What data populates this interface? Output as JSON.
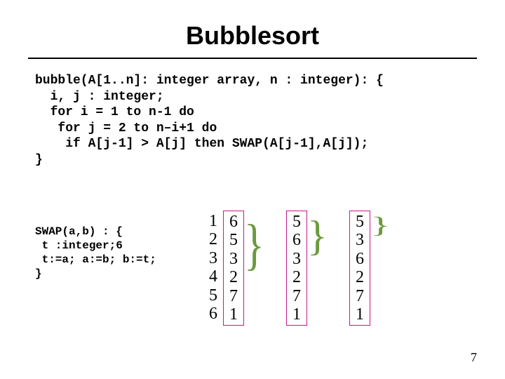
{
  "title": "Bubblesort",
  "code_main": "bubble(A[1..n]: integer array, n : integer): {\n  i, j : integer;\n  for i = 1 to n-1 do\n   for j = 2 to n–i+1 do\n    if A[j-1] > A[j] then SWAP(A[j-1],A[j]);\n}",
  "code_swap": "SWAP(a,b) : {\n t :integer;6\n t:=a; a:=b; b:=t;\n}",
  "columns": {
    "index": [
      "1",
      "2",
      "3",
      "4",
      "5",
      "6"
    ],
    "pass0": [
      "6",
      "5",
      "3",
      "2",
      "7",
      "1"
    ],
    "pass1": [
      "5",
      "6",
      "3",
      "2",
      "7",
      "1"
    ],
    "pass2": [
      "5",
      "3",
      "6",
      "2",
      "7",
      "1"
    ]
  },
  "page_number": "7"
}
